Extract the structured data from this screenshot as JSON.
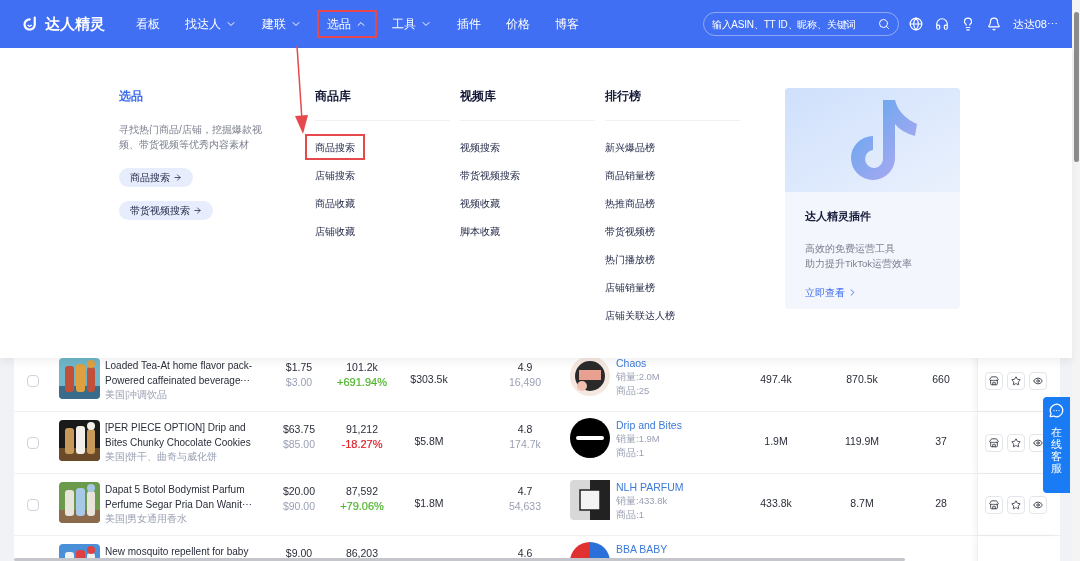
{
  "header": {
    "logo": "达人精灵",
    "nav": [
      {
        "label": "看板",
        "has_menu": false,
        "expanded": false,
        "highlighted": false
      },
      {
        "label": "找达人",
        "has_menu": true,
        "expanded": false,
        "highlighted": false
      },
      {
        "label": "建联",
        "has_menu": true,
        "expanded": false,
        "highlighted": false
      },
      {
        "label": "选品",
        "has_menu": true,
        "expanded": true,
        "highlighted": true
      },
      {
        "label": "工具",
        "has_menu": true,
        "expanded": false,
        "highlighted": false
      },
      {
        "label": "插件",
        "has_menu": false,
        "expanded": false,
        "highlighted": false
      },
      {
        "label": "价格",
        "has_menu": false,
        "expanded": false,
        "highlighted": false
      },
      {
        "label": "博客",
        "has_menu": false,
        "expanded": false,
        "highlighted": false
      }
    ],
    "search": {
      "placeholder": "输入ASIN、TT ID、昵称、关键词"
    },
    "user": "达达08⋯"
  },
  "mega_menu": {
    "intro": {
      "title": "选品",
      "description": "寻找热门商品/店铺，挖掘爆款视频、带货视频等优秀内容素材",
      "buttons": [
        "商品搜索",
        "带货视频搜索"
      ]
    },
    "columns": [
      {
        "title": "商品库",
        "items": [
          {
            "label": "商品搜索",
            "highlighted": true
          },
          {
            "label": "店铺搜索",
            "highlighted": false
          },
          {
            "label": "商品收藏",
            "highlighted": false
          },
          {
            "label": "店铺收藏",
            "highlighted": false
          }
        ]
      },
      {
        "title": "视频库",
        "items": [
          {
            "label": "视频搜索",
            "highlighted": false
          },
          {
            "label": "带货视频搜索",
            "highlighted": false
          },
          {
            "label": "视频收藏",
            "highlighted": false
          },
          {
            "label": "脚本收藏",
            "highlighted": false
          }
        ]
      },
      {
        "title": "排行榜",
        "items": [
          {
            "label": "新兴爆品榜",
            "highlighted": false
          },
          {
            "label": "商品销量榜",
            "highlighted": false
          },
          {
            "label": "热推商品榜",
            "highlighted": false
          },
          {
            "label": "带货视频榜",
            "highlighted": false
          },
          {
            "label": "热门播放榜",
            "highlighted": false
          },
          {
            "label": "店铺销量榜",
            "highlighted": false
          },
          {
            "label": "店铺关联达人榜",
            "highlighted": false
          }
        ]
      }
    ],
    "promo": {
      "title": "达人精灵插件",
      "lines": [
        "高效的免费运营工具",
        "助力提升TikTok运营效率"
      ],
      "link": "立即查看"
    }
  },
  "table": {
    "rows": [
      {
        "title_lines": [
          "Loaded Tea-At home flavor pack-",
          "Powered caffeinated beverage⋯"
        ],
        "category": "美国|冲调饮品",
        "price": "$1.75",
        "original_price": "$3.00",
        "sales": "101.2k",
        "growth": {
          "text": "+691.94%",
          "color": "#52b530"
        },
        "checked": false,
        "revenue": "$303.5k",
        "rating": "4.9",
        "reviews": "16,490",
        "shop": "Chaos",
        "shop_sales": "销量:2.0M",
        "shop_products": "商品:25",
        "column_a": "497.4k",
        "column_b": "870.5k",
        "column_c": "660"
      },
      {
        "title_lines": [
          "[PER PIECE OPTION] Drip and",
          "Bites Chunky Chocolate Cookies"
        ],
        "category": "美国|饼干、曲奇与威化饼",
        "price": "$63.75",
        "original_price": "$85.00",
        "sales": "91,212",
        "growth": {
          "text": "-18.27%",
          "color": "#e0202a"
        },
        "checked": false,
        "revenue": "$5.8M",
        "rating": "4.8",
        "reviews": "174.7k",
        "shop": "Drip and Bites",
        "shop_sales": "销量:1.9M",
        "shop_products": "商品:1",
        "column_a": "1.9M",
        "column_b": "119.9M",
        "column_c": "37"
      },
      {
        "title_lines": [
          "Dapat 5 Botol Bodymist Parfum",
          "Perfume Segar Pria Dan Wanit⋯"
        ],
        "category": "美国|男女通用香水",
        "price": "$20.00",
        "original_price": "$90.00",
        "sales": "87,592",
        "growth": {
          "text": "+79.06%",
          "color": "#52b530"
        },
        "checked": false,
        "revenue": "$1.8M",
        "rating": "4.7",
        "reviews": "54,633",
        "shop": "NLH PARFUM",
        "shop_sales": "销量:433.8k",
        "shop_products": "商品:1",
        "column_a": "433.8k",
        "column_b": "8.7M",
        "column_c": "28"
      },
      {
        "title_lines": [
          "New mosquito repellent for baby"
        ],
        "price": "$9.00",
        "sales": "86,203",
        "rating": "4.6",
        "shop": "BBA BABY"
      }
    ]
  },
  "chat_button": {
    "label": "在线客服"
  }
}
